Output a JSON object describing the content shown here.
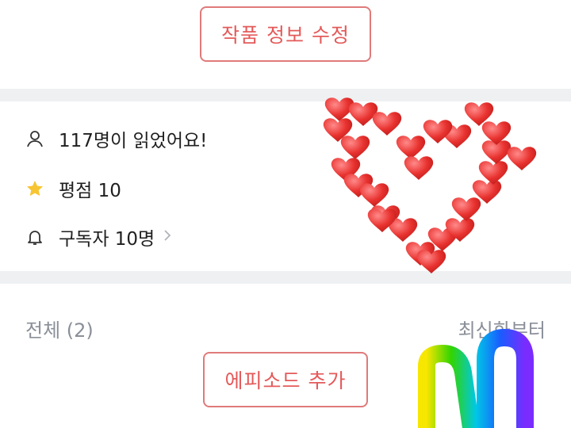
{
  "work": {
    "edit_button_label": "작품 정보 수정"
  },
  "stats": {
    "readers_text": "117명이 읽었어요!",
    "rating_text": "평점 10",
    "subscribers_text": "구독자 10명",
    "icons": [
      "person-icon",
      "star-icon",
      "bell-icon",
      "chevron-right-icon"
    ],
    "star_color": "#f7c531"
  },
  "episodes": {
    "section_title": "전체 (2)",
    "sort_label": "최신화부터",
    "add_button_label": "에피소드 추가"
  },
  "accent_color": "#e45a5a"
}
